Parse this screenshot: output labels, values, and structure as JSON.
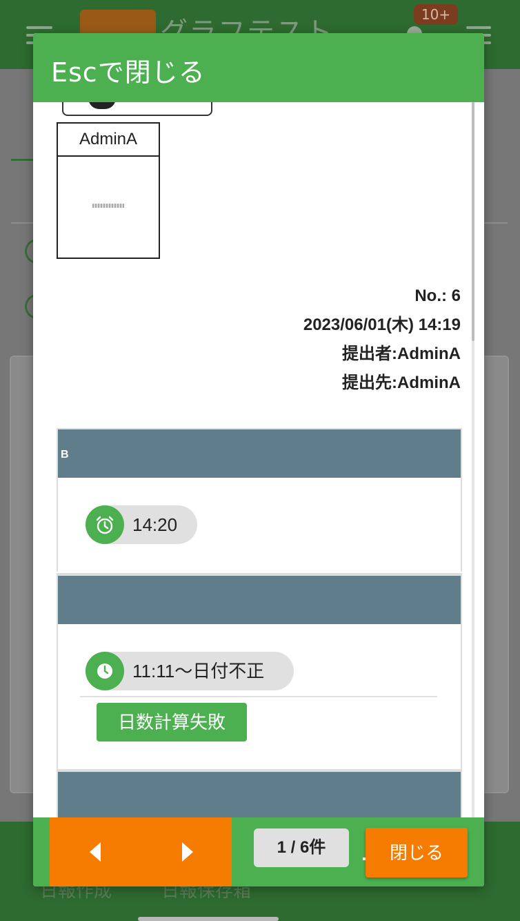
{
  "background": {
    "app_title": "グラフテスト",
    "notification_badge": "10+",
    "footer_tabs": [
      "日報作成",
      "日報保存箱"
    ]
  },
  "modal": {
    "header_title": "Escで閉じる",
    "stamp": {
      "name": "AdminA"
    },
    "meta": {
      "number": "No.: 6",
      "datetime": "2023/06/01(木) 14:19",
      "submitter": "提出者:AdminA",
      "recipient": "提出先:AdminA"
    },
    "sections": [
      {
        "header": "B",
        "chip": {
          "icon": "alarm-clock-icon",
          "label": "14:20"
        }
      },
      {
        "header": "",
        "chip": {
          "icon": "clock-icon",
          "label": "11:11〜日付不正"
        },
        "tag": "日数計算失敗"
      },
      {
        "header": ""
      }
    ]
  },
  "footer": {
    "page_count": "1 / 6件",
    "close_label": "閉じる"
  },
  "colors": {
    "primary_green": "#4caf50",
    "accent_orange": "#f57c00",
    "section_header": "#607d8b"
  }
}
